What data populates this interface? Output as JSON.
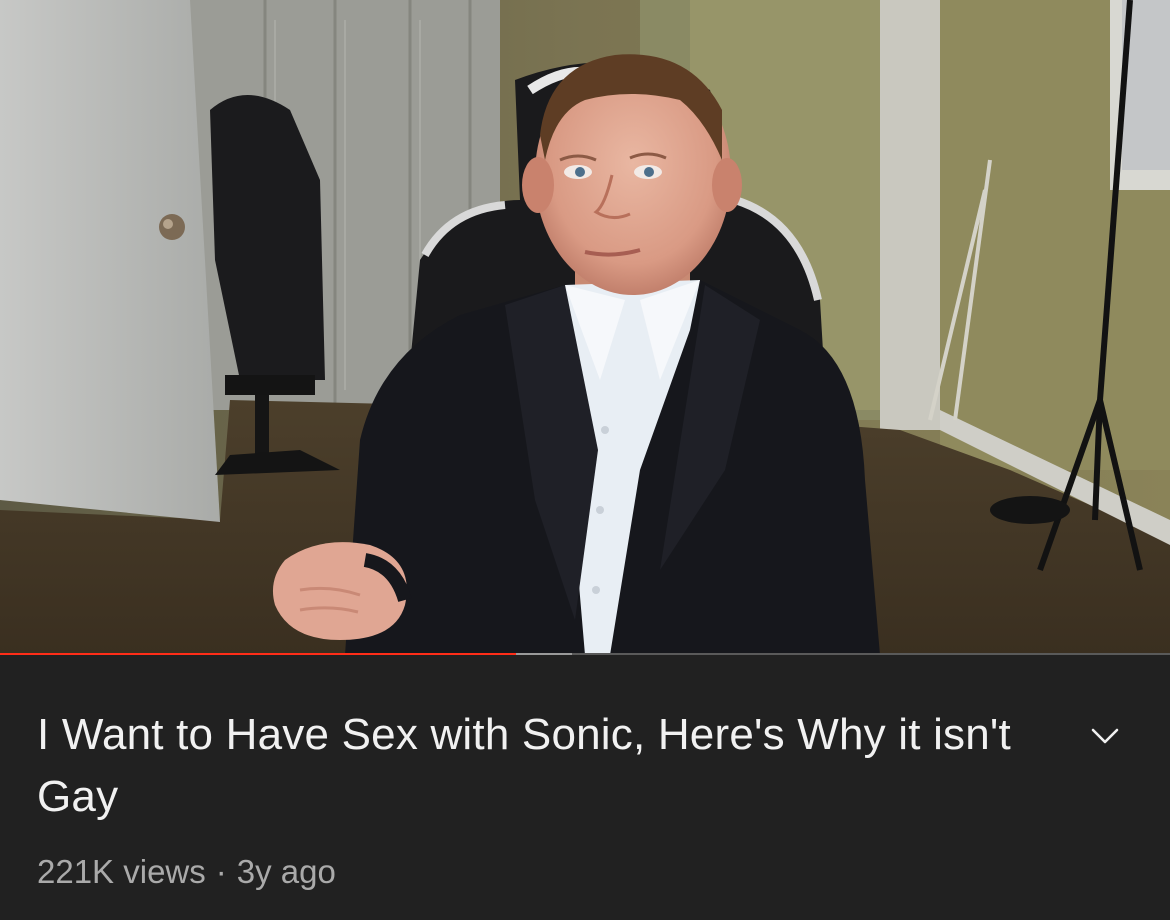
{
  "player": {
    "progress_played": 0.441,
    "progress_buffered": 0.489,
    "colors": {
      "played": "#ff2d18",
      "buffered": "#9a9a9a",
      "track": "#5a5a5a"
    }
  },
  "video": {
    "title": "I Want to Have Sex with Sonic, Here's Why it isn't Gay",
    "views": "221K views",
    "separator": "·",
    "age": "3y ago"
  },
  "icons": {
    "expand": "chevron-down-icon"
  }
}
